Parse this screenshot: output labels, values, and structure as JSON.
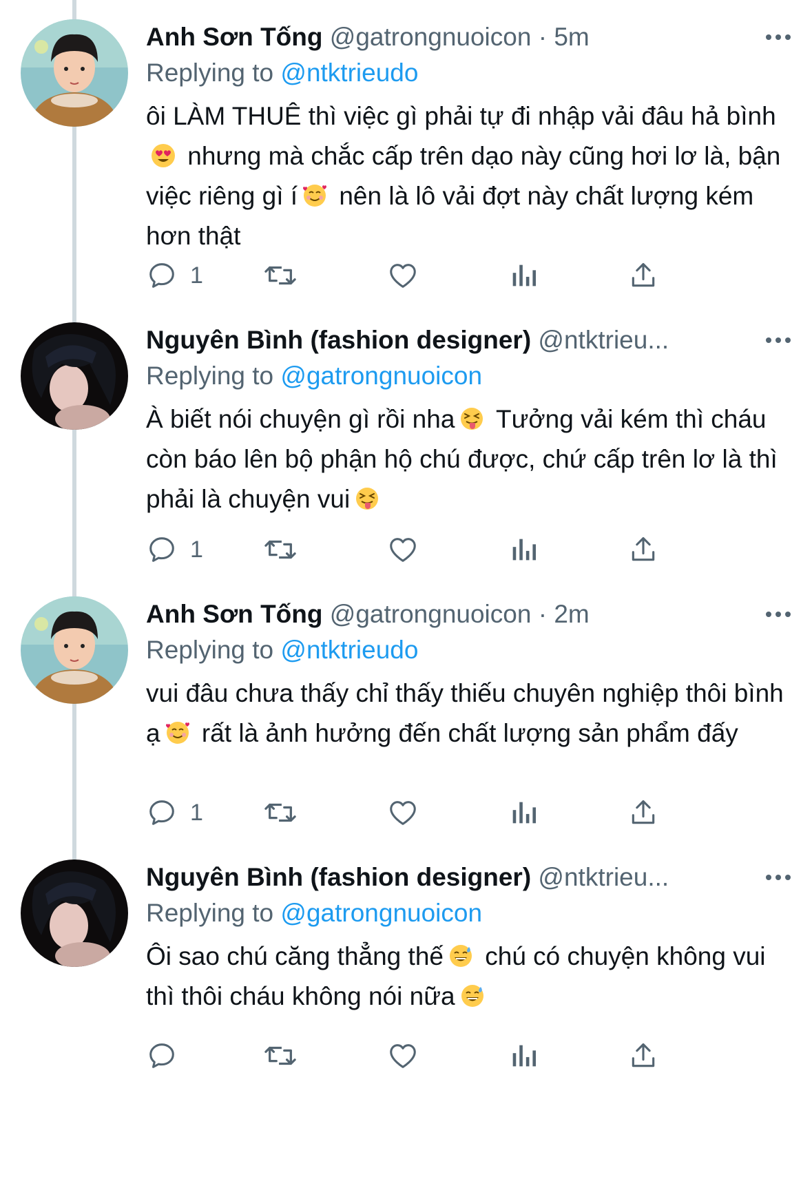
{
  "tweets": [
    {
      "name": "Anh Sơn Tống",
      "handle": "@gatrongnuoicon",
      "time": "· 5m",
      "replying_label": "Replying to",
      "replying_to": "@ntktrieudo",
      "body_parts": [
        "ôi LÀM THUÊ thì việc gì phải tự đi nhập vải đâu hả bình",
        " nhưng mà chắc cấp trên dạo này cũng hơi lơ là, bận việc riêng gì í",
        " nên là lô vải đợt này chất lượng kém hơn thật"
      ],
      "reply_count": "1"
    },
    {
      "name": "Nguyên Bình (fashion designer)",
      "handle": "@ntktrieu...",
      "time": "",
      "replying_label": "Replying to",
      "replying_to": "@gatrongnuoicon",
      "body_parts": [
        "À biết nói chuyện gì rồi nha",
        " Tưởng vải kém thì cháu còn báo lên bộ phận hộ chú được, chứ cấp trên lơ là thì phải là chuyện vui",
        ""
      ],
      "reply_count": "1"
    },
    {
      "name": "Anh Sơn Tống",
      "handle": "@gatrongnuoicon",
      "time": "· 2m",
      "replying_label": "Replying to",
      "replying_to": "@ntktrieudo",
      "body_parts": [
        "vui đâu chưa thấy chỉ thấy thiếu chuyên nghiệp thôi bình ạ",
        " rất là ảnh hưởng đến chất lượng sản phẩm đấy"
      ],
      "reply_count": "1"
    },
    {
      "name": "Nguyên Bình (fashion designer)",
      "handle": "@ntktrieu...",
      "time": "",
      "replying_label": "Replying to",
      "replying_to": "@gatrongnuoicon",
      "body_parts": [
        "Ôi sao chú căng thẳng thế",
        " chú có chuyện không vui thì thôi cháu không nói nữa",
        ""
      ],
      "reply_count": ""
    }
  ],
  "icons": {
    "reply": "reply-icon",
    "retweet": "retweet-icon",
    "like": "heart-icon",
    "analytics": "analytics-icon",
    "share": "share-icon",
    "more": "more-icon",
    "emoji_heart_eyes": "heart-eyes-emoji",
    "emoji_hearts": "smiling-face-with-hearts-emoji",
    "emoji_squint_tongue": "squinting-tongue-emoji",
    "emoji_sweat_smile": "sweat-smile-emoji"
  },
  "colors": {
    "text": "#0f1419",
    "secondary": "#536471",
    "link": "#1d9bf0",
    "thread_line": "#cfd9de"
  }
}
